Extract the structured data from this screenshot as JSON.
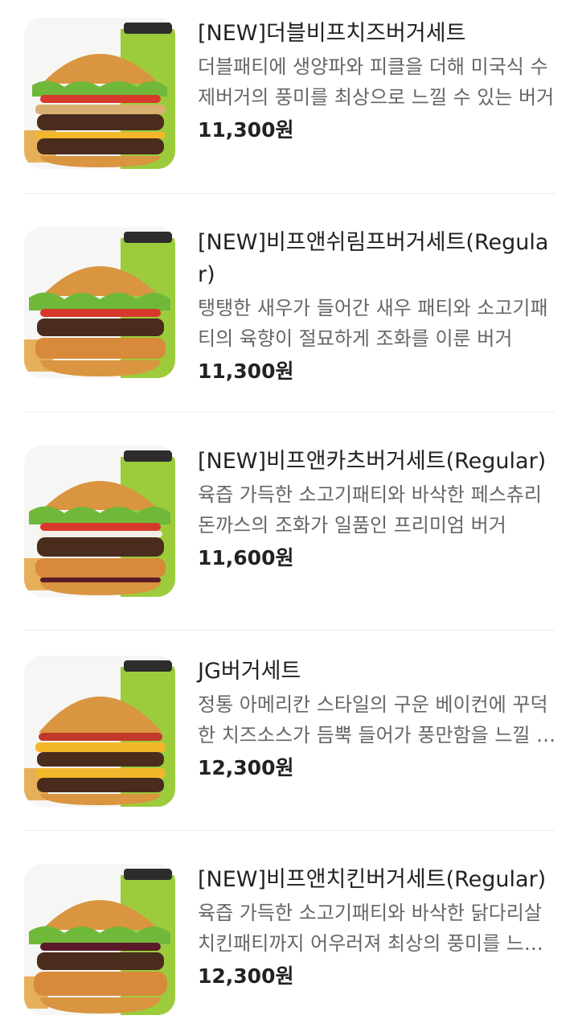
{
  "menu_items": [
    {
      "title": "[NEW]더블비프치즈버거세트",
      "description": "더블패티에 생양파와 피클을 더해 미국식 수제버거의 풍미를 최상으로 느낄 수 있는 버거",
      "price": "11,300원",
      "image_icon": "double-beef-cheese-burger-set-image"
    },
    {
      "title": "[NEW]비프앤쉬림프버거세트(Regular)",
      "description": "탱탱한 새우가 들어간 새우 패티와 소고기패티의 육향이 절묘하게 조화를 이룬 버거",
      "price": "11,300원",
      "image_icon": "beef-shrimp-burger-set-image"
    },
    {
      "title": "[NEW]비프앤카츠버거세트(Regular)",
      "description": "육즙 가득한 소고기패티와 바삭한 페스츄리 돈까스의 조화가 일품인 프리미엄 버거",
      "price": "11,600원",
      "image_icon": "beef-katsu-burger-set-image"
    },
    {
      "title": "JG버거세트",
      "description": "정통 아메리칸 스타일의 구운 베이컨에 꾸덕한 치즈소스가 듬뿍 들어가 풍만함을 느낄 수 있는 버거",
      "price": "12,300원",
      "image_icon": "jg-burger-set-image"
    },
    {
      "title": "[NEW]비프앤치킨버거세트(Regular)",
      "description": "육즙 가득한 소고기패티와 바삭한 닭다리살 치킨패티까지 어우러져 최상의 풍미를 느낄 수 있는 버거",
      "price": "12,300원",
      "image_icon": "beef-chicken-burger-set-image"
    }
  ],
  "colors": {
    "bun": "#d9953f",
    "lettuce": "#6fb83a",
    "cup": "#9ccc3c",
    "patty": "#4a2c1d",
    "cheese": "#f3b72b",
    "tomato": "#d6392c",
    "fried": "#d68a3a"
  }
}
